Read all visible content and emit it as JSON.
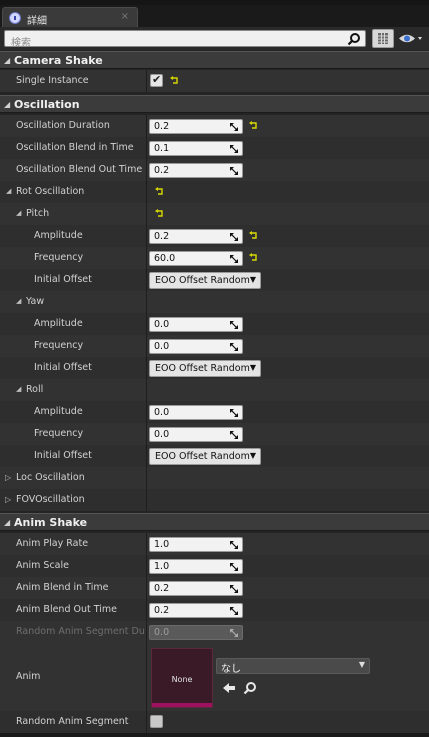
{
  "tab": {
    "title": "詳細",
    "icon": "details-info-icon",
    "close": "×"
  },
  "search": {
    "placeholder": "検索"
  },
  "colors": {
    "panel_bg": "#242424",
    "row_bg": "#323232",
    "category_bg": "#3b3b3b",
    "reset_arrow": "#d8d800",
    "thumb_accent": "#a01060"
  },
  "sections": {
    "camera_shake": {
      "title": "Camera Shake",
      "single_instance_label": "Single Instance",
      "single_instance_checked": true
    },
    "oscillation": {
      "title": "Oscillation",
      "duration_label": "Oscillation Duration",
      "duration_value": "0.2",
      "blend_in_label": "Oscillation Blend in Time",
      "blend_in_value": "0.1",
      "blend_out_label": "Oscillation Blend Out Time",
      "blend_out_value": "0.2",
      "rot_label": "Rot Oscillation",
      "pitch": {
        "label": "Pitch",
        "amplitude_label": "Amplitude",
        "amplitude": "0.2",
        "frequency_label": "Frequency",
        "frequency": "60.0",
        "offset_label": "Initial Offset",
        "offset": "EOO Offset Random"
      },
      "yaw": {
        "label": "Yaw",
        "amplitude_label": "Amplitude",
        "amplitude": "0.0",
        "frequency_label": "Frequency",
        "frequency": "0.0",
        "offset_label": "Initial Offset",
        "offset": "EOO Offset Random"
      },
      "roll": {
        "label": "Roll",
        "amplitude_label": "Amplitude",
        "amplitude": "0.0",
        "frequency_label": "Frequency",
        "frequency": "0.0",
        "offset_label": "Initial Offset",
        "offset": "EOO Offset Random"
      },
      "loc_label": "Loc Oscillation",
      "fov_label": "FOVOscillation"
    },
    "anim_shake": {
      "title": "Anim Shake",
      "play_rate_label": "Anim Play Rate",
      "play_rate": "1.0",
      "scale_label": "Anim Scale",
      "scale": "1.0",
      "blend_in_label": "Anim Blend in Time",
      "blend_in": "0.2",
      "blend_out_label": "Anim Blend Out Time",
      "blend_out": "0.2",
      "segment_duration_label": "Random Anim Segment Dura",
      "segment_duration": "0.0",
      "anim_label": "Anim",
      "anim_thumb_text": "None",
      "anim_asset": "なし",
      "random_segment_label": "Random Anim Segment",
      "random_segment_checked": false
    }
  }
}
